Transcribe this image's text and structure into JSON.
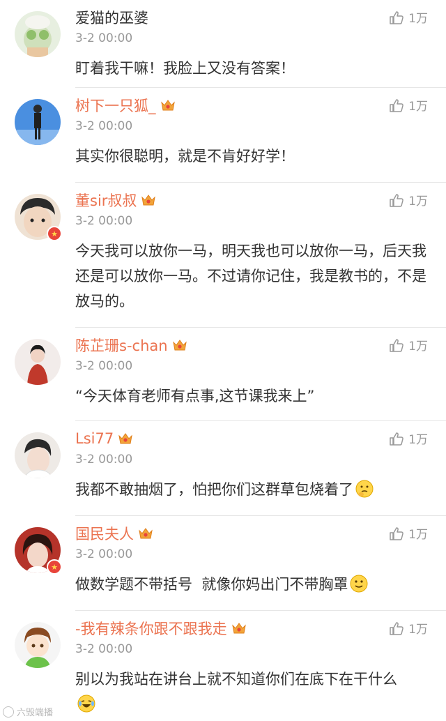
{
  "comments": [
    {
      "name": "爱猫的巫婆",
      "vip": false,
      "time": "3-2 00:00",
      "likes": "1万",
      "text": "盯着我干嘛！我脸上又没有答案！",
      "avatar_color": "#c9d8b0"
    },
    {
      "name": "树下一只狐_",
      "vip": true,
      "time": "3-2 00:00",
      "likes": "1万",
      "text": "其实你很聪明，就是不肯好好学！",
      "avatar_color": "#3b7fd1"
    },
    {
      "name": "董sir叔叔",
      "vip": true,
      "verified": true,
      "time": "3-2 00:00",
      "likes": "1万",
      "text": "今天我可以放你一马，明天我也可以放你一马，后天我还是可以放你一马。不过请你记住，我是教书的，不是放马的。",
      "avatar_color": "#e7cdb6"
    },
    {
      "name": "陈芷珊s-chan",
      "vip": true,
      "time": "3-2 00:00",
      "likes": "1万",
      "text": "“今天体育老师有点事,这节课我来上”",
      "avatar_color": "#c0392b"
    },
    {
      "name": "Lsi77",
      "vip": true,
      "time": "3-2 00:00",
      "likes": "1万",
      "text": "我都不敢抽烟了，怕把你们这群草包烧着了",
      "emoji": "thinking",
      "avatar_color": "#d9d2cc"
    },
    {
      "name": "国民夫人",
      "vip": true,
      "verified": true,
      "time": "3-2 00:00",
      "likes": "1万",
      "text": "做数学题不带括号  就像你妈出门不带胸罩",
      "emoji": "smile",
      "avatar_color": "#e09b8e"
    },
    {
      "name": "-我有辣条你跟不跟我走",
      "vip": true,
      "time": "3-2 00:00",
      "likes": "1万",
      "text": "别以为我站在讲台上就不知道你们在底下在干什么",
      "emoji": "laugh",
      "avatar_color": "#7bc96f"
    }
  ],
  "watermark": "六毁端播"
}
